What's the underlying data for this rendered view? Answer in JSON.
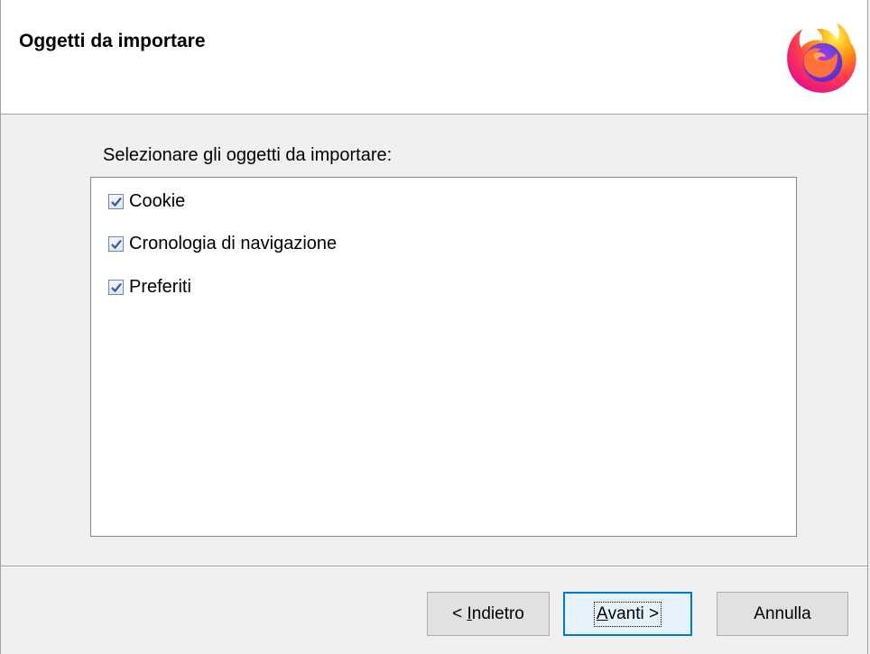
{
  "header": {
    "title": "Oggetti da importare",
    "logo_icon": "firefox-logo"
  },
  "main": {
    "prompt": "Selezionare gli oggetti da importare:",
    "items": [
      {
        "label": "Cookie",
        "checked": true
      },
      {
        "label": "Cronologia di navigazione",
        "checked": true
      },
      {
        "label": "Preferiti",
        "checked": true
      }
    ]
  },
  "footer": {
    "back_prefix": "< ",
    "back_mnemonic": "I",
    "back_rest": "ndietro",
    "next_mnemonic": "A",
    "next_rest": "vanti >",
    "cancel_label": "Annulla"
  },
  "colors": {
    "accent": "#0078d7",
    "checkmark": "#2a5aa6"
  }
}
